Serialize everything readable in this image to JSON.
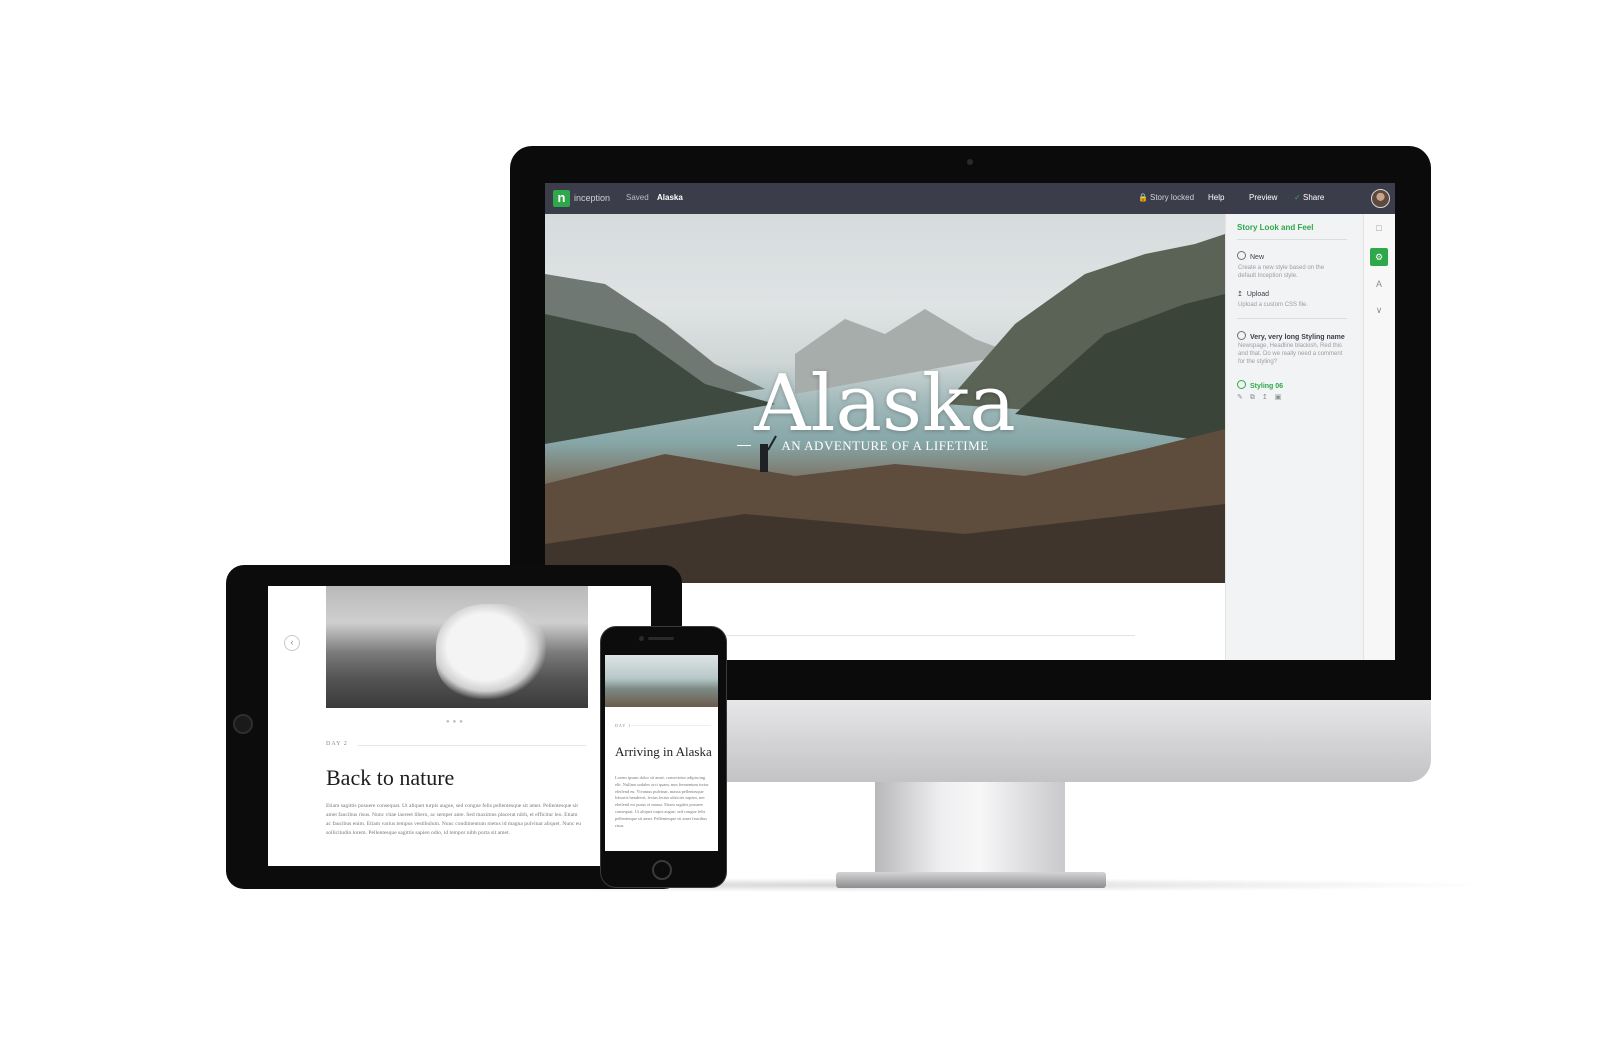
{
  "app": {
    "brand": "inception",
    "logo_letter": "n",
    "status_saved": "Saved",
    "story_name": "Alaska",
    "story_locked": "Story locked",
    "nav": {
      "help": "Help",
      "preview": "Preview",
      "share": "Share"
    },
    "accent_color": "#2ea84a",
    "topbar_color": "#3b3e4a"
  },
  "hero": {
    "title": "Alaska",
    "subtitle": "AN ADVENTURE OF A LIFETIME"
  },
  "panel": {
    "heading": "Story Look and Feel",
    "new_label": "New",
    "new_desc": "Create a new style based on the default Inception style.",
    "upload_label": "Upload",
    "upload_desc": "Upload a custom CSS file.",
    "styling1_name": "Very, very long Styling name",
    "styling1_desc": "Newspage, Headline blackish, Red this and that. Do we really need a comment for the styling?",
    "styling2_name": "Styling 06"
  },
  "tablet": {
    "day_label": "DAY 2",
    "title": "Back to nature",
    "body": "Etiam sagittis posuere consequat. Ut aliquet turpis augue, sed congue felis pellentesque sit amet. Pellentesque sit amet faucibus risus. Nunc vitae laoreet libero, ac semper ante. Sed maximus placerat nibh, et efficitur leo. Etiam ac faucibus enim. Etiam varius tempus vestibulum. Nunc condimentum metus id magna pulvinar aliquet. Nunc eu sollicitudin lorem. Pellentesque sagittis sapien odio, id tempor nibh porta sit amet."
  },
  "phone": {
    "day_label": "DAY 1",
    "title": "Arriving in Alaska",
    "body": "Lorem ipsum dolor sit amet, consectetur adipiscing elit. Nullam sodales orci quam, non fermentum tortor eleifend eu. Vivamus pulvinar, massa pellentesque lobortis hendrerit, lectus lectus ultricies sapien, nec eleifend est purus et massa. Etiam sagittis posuere consequat. Ut aliquet turpis augue, sed congue felis pellentesque sit amet. Pellentesque sit amet faucibus risus."
  }
}
